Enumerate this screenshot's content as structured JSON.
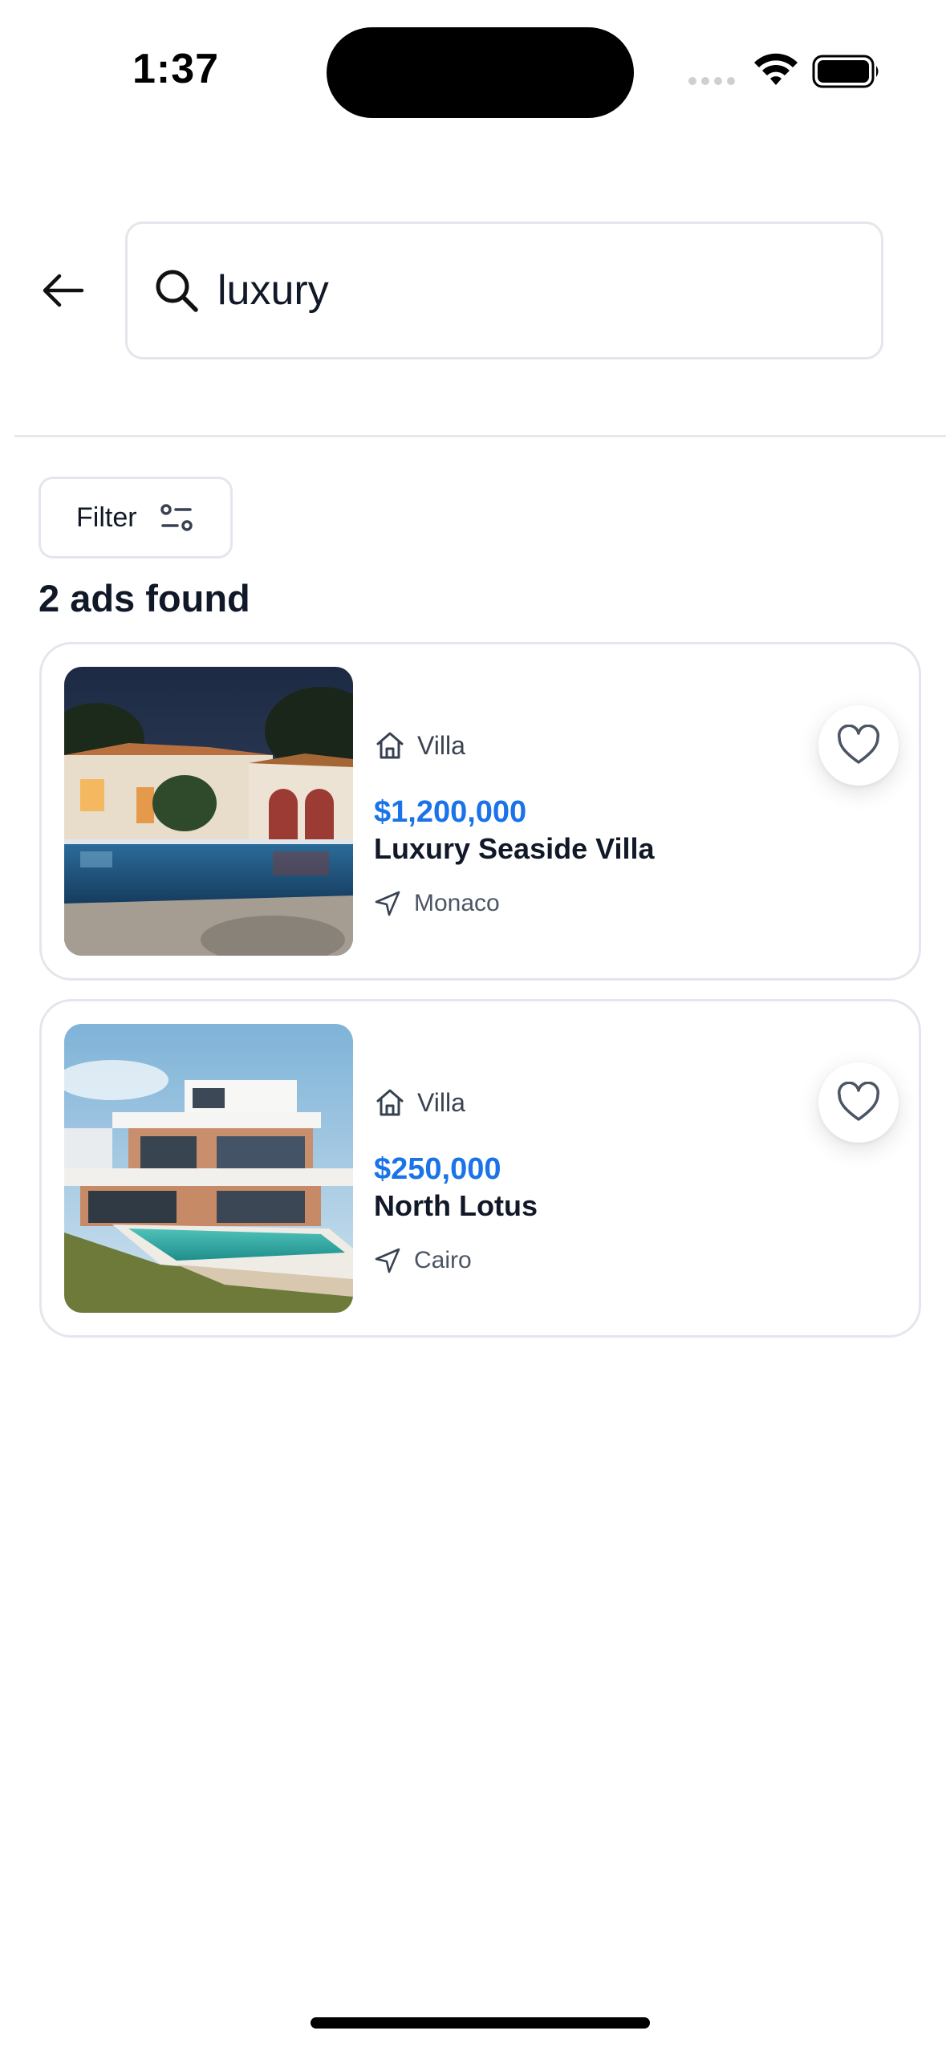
{
  "status_bar": {
    "time": "1:37",
    "icons": [
      "cellular-dots-icon",
      "wifi-icon",
      "battery-icon"
    ]
  },
  "search": {
    "back_icon": "arrow-left-icon",
    "query": "luxury",
    "search_icon": "search-icon"
  },
  "filter": {
    "label": "Filter",
    "icon": "sliders-icon"
  },
  "results": {
    "count_text": "2 ads found"
  },
  "listings": [
    {
      "type": "Villa",
      "price": "$1,200,000",
      "title": "Luxury Seaside Villa",
      "location": "Monaco",
      "favorite": false
    },
    {
      "type": "Villa",
      "price": "$250,000",
      "title": "North Lotus",
      "location": "Cairo",
      "favorite": false
    }
  ],
  "colors": {
    "price": "#1a73e8",
    "text": "#111827",
    "border": "#e3e6ec"
  }
}
